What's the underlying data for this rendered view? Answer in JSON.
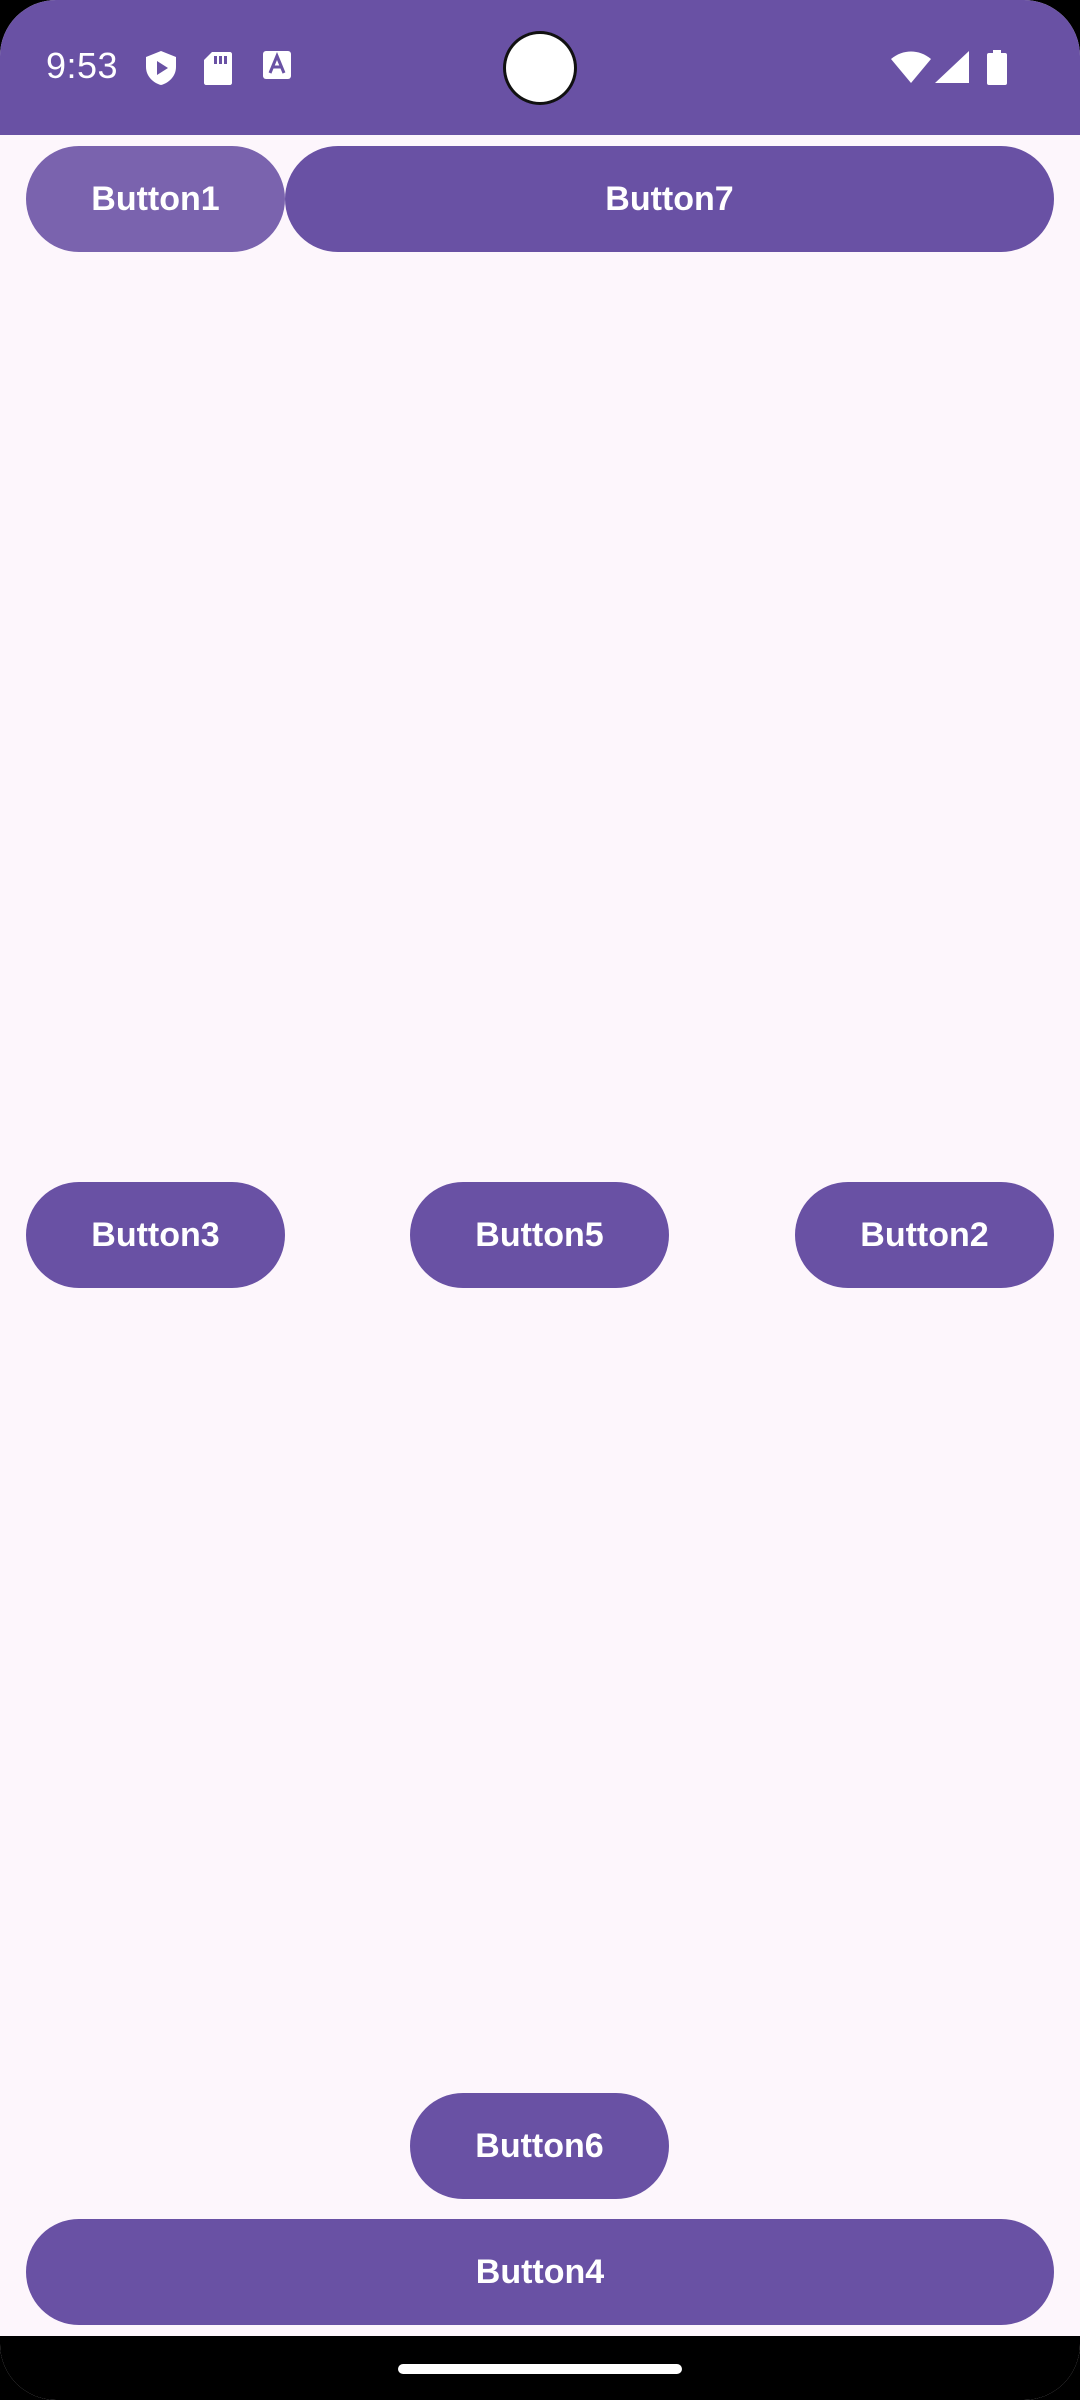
{
  "status_bar": {
    "time": "9:53",
    "background_color": "#6951A4",
    "left_icons": [
      "shield-play-icon",
      "sd-card-icon",
      "text-a-icon"
    ],
    "right_icons": [
      "wifi-icon",
      "cell-signal-icon",
      "battery-icon"
    ]
  },
  "theme": {
    "button_color": "#6951A4",
    "button_pressed_color": "#7A63AE",
    "page_background": "#FDF6FC"
  },
  "buttons": {
    "button1": "Button1",
    "button2": "Button2",
    "button3": "Button3",
    "button4": "Button4",
    "button5": "Button5",
    "button6": "Button6",
    "button7": "Button7"
  }
}
